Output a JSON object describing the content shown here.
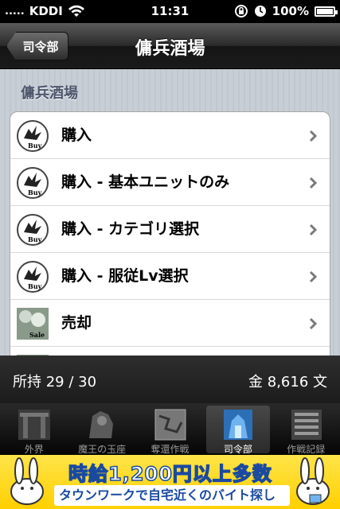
{
  "status_bar": {
    "signal": ".....",
    "carrier": "KDDI",
    "time": "11:31",
    "battery": "100%"
  },
  "nav": {
    "back_label": "司令部",
    "title": "傭兵酒場"
  },
  "section_header": "傭兵酒場",
  "rows": [
    {
      "label": "購入",
      "icon": "dragon-buy-icon"
    },
    {
      "label": "購入 - 基本ユニットのみ",
      "icon": "dragon-buy-icon"
    },
    {
      "label": "購入 - カテゴリ選択",
      "icon": "dragon-buy-icon"
    },
    {
      "label": "購入 - 服従Lv選択",
      "icon": "dragon-buy-icon"
    },
    {
      "label": "売却",
      "icon": "sale-icon"
    }
  ],
  "info_bar": {
    "owned": "所持 29 / 30",
    "money": "金 8,616 文"
  },
  "tabs": [
    {
      "label": "外界",
      "icon": "gate-icon",
      "active": false
    },
    {
      "label": "魔王の玉座",
      "icon": "throne-icon",
      "active": false
    },
    {
      "label": "奪還作戦",
      "icon": "map-icon",
      "active": false
    },
    {
      "label": "司令部",
      "icon": "headquarters-icon",
      "active": true
    },
    {
      "label": "作戦記録",
      "icon": "records-icon",
      "active": false
    }
  ],
  "ad": {
    "line1": "時給1,200円以上多数",
    "line2": "タウンワークで自宅近くのバイト探し"
  },
  "colors": {
    "accent_blue": "#1a4aa0",
    "ad_yellow": "#ffd000",
    "section_header": "#4c566c"
  }
}
